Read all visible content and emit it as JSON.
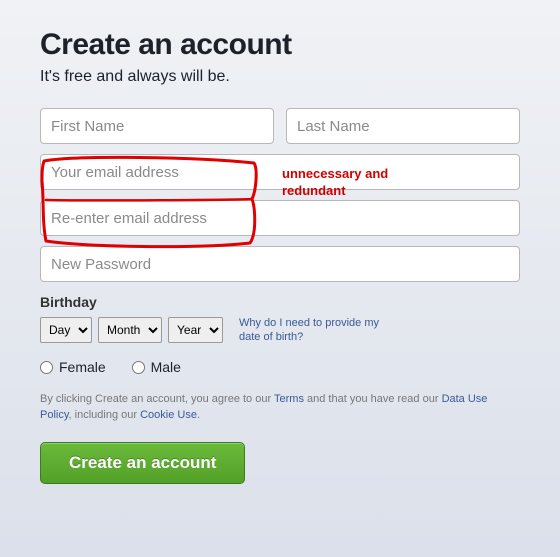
{
  "header": {
    "title": "Create an account",
    "subtitle": "It's free and always will be."
  },
  "fields": {
    "first_name_placeholder": "First Name",
    "last_name_placeholder": "Last Name",
    "email_placeholder": "Your email address",
    "reemail_placeholder": "Re-enter email address",
    "password_placeholder": "New Password"
  },
  "birthday": {
    "label": "Birthday",
    "day": "Day",
    "month": "Month",
    "year": "Year",
    "why_link": "Why do I need to provide my date of birth?"
  },
  "gender": {
    "female": "Female",
    "male": "Male"
  },
  "legal": {
    "prefix": "By clicking Create an account, you agree to our ",
    "terms": "Terms",
    "mid1": " and that you have read our ",
    "data_policy": "Data Use Policy",
    "mid2": ", including our ",
    "cookie": "Cookie Use",
    "suffix": "."
  },
  "button": {
    "create": "Create an account"
  },
  "annotation": {
    "text": "unnecessary and redundant"
  }
}
